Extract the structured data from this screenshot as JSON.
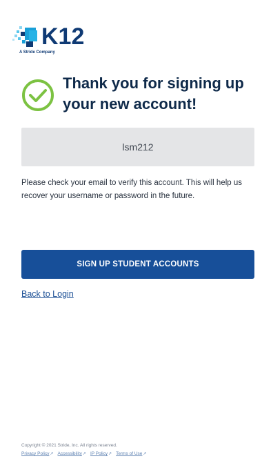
{
  "logo": {
    "brand": "K12",
    "tagline": "A Stride Company"
  },
  "confirmation": {
    "icon": "check-circle-icon",
    "heading": "Thank you for signing up your new account!",
    "username": "lsm212",
    "message": "Please check your email to verify this account. This will help us recover your username or password in the future."
  },
  "actions": {
    "signup_label": "SIGN UP STUDENT ACCOUNTS",
    "back_label": "Back to Login"
  },
  "footer": {
    "copyright": "Copyright © 2021 Stride, Inc. All rights reserved.",
    "links": [
      {
        "label": "Privacy Policy"
      },
      {
        "label": "Accessibility"
      },
      {
        "label": "IP Policy"
      },
      {
        "label": "Terms of Use"
      }
    ]
  },
  "colors": {
    "brand_blue": "#0f3a74",
    "button_blue": "#174f99",
    "success_green": "#7cc242",
    "username_box_bg": "#e4e5e7"
  }
}
